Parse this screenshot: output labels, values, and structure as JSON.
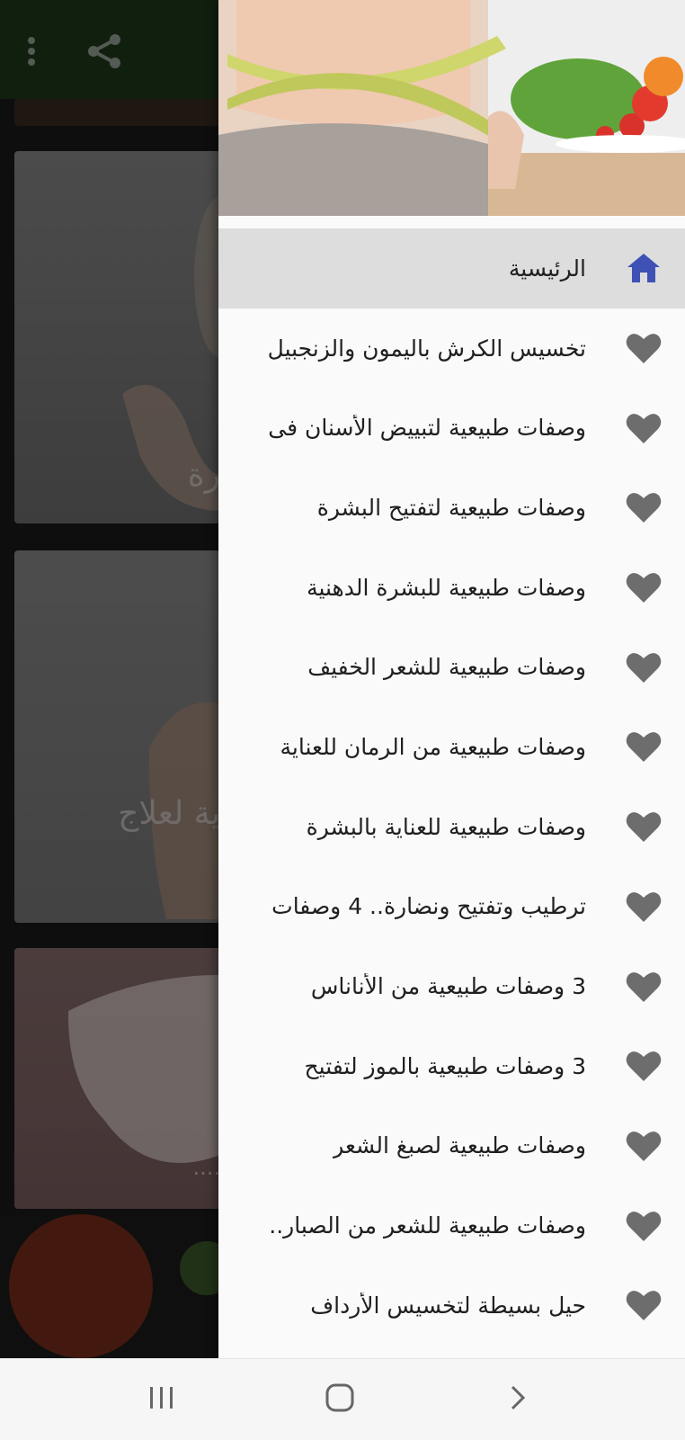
{
  "menu": {
    "items": [
      {
        "label": "الرئيسية",
        "icon": "home-icon",
        "active": true
      },
      {
        "label": "تخسيس الكرش باليمون والزنجبيل",
        "icon": "heart-icon"
      },
      {
        "label": "وصفات طبيعية لتبييض الأسنان فى",
        "icon": "heart-icon"
      },
      {
        "label": "وصفات طبيعية لتفتيح البشرة",
        "icon": "heart-icon"
      },
      {
        "label": "وصفات طبيعية للبشرة الدهنية",
        "icon": "heart-icon"
      },
      {
        "label": "وصفات طبيعية للشعر الخفيف",
        "icon": "heart-icon"
      },
      {
        "label": "وصفات طبيعية من الرمان للعناية",
        "icon": "heart-icon"
      },
      {
        "label": "وصفات طبيعية للعناية بالبشرة",
        "icon": "heart-icon"
      },
      {
        "label": "ترطيب وتفتيح ونضارة.. 4 وصفات",
        "icon": "heart-icon"
      },
      {
        "label": "3 وصفات طبيعية من الأناناس",
        "icon": "heart-icon"
      },
      {
        "label": "3 وصفات طبيعية بالموز لتفتيح",
        "icon": "heart-icon"
      },
      {
        "label": "وصفات طبيعية لصبغ الشعر",
        "icon": "heart-icon"
      },
      {
        "label": "وصفات طبيعية للشعر من الصبار..",
        "icon": "heart-icon"
      },
      {
        "label": "حيل بسيطة لتخسيس الأرداف",
        "icon": "heart-icon"
      }
    ]
  },
  "background": {
    "card1_text": "رة",
    "card2_text": "ية لعلاج",
    "card3_text": "...."
  },
  "colors": {
    "appbar": "#1f3a1c",
    "active_item": "#dddddd",
    "home_icon": "#3f51b5",
    "heart_icon": "#6d6d6d"
  }
}
